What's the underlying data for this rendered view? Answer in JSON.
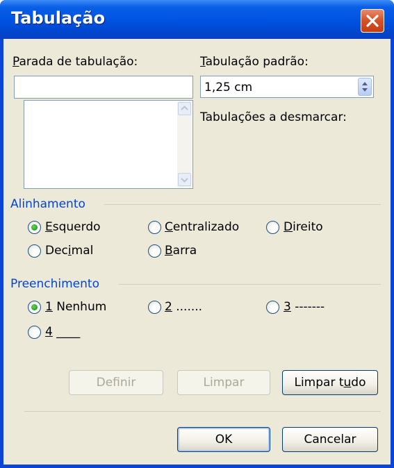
{
  "window": {
    "title": "Tabulação"
  },
  "tab_stop": {
    "label_prefix": "P",
    "label_rest": "arada de tabulação:",
    "value": ""
  },
  "default_tab": {
    "label_prefix": "T",
    "label_rest": "abulação padrão:",
    "value": "1,25 cm"
  },
  "clear_label": "Tabulações a desmarcar:",
  "alignment": {
    "title": "Alinhamento",
    "options": [
      {
        "u": "E",
        "rest": "squerdo",
        "pre": "",
        "selected": true
      },
      {
        "u": "C",
        "rest": "entralizado",
        "pre": "",
        "selected": false
      },
      {
        "u": "D",
        "rest": "ireito",
        "pre": "",
        "selected": false
      },
      {
        "pre": "Dec",
        "u": "i",
        "rest": "mal",
        "selected": false
      },
      {
        "u": "B",
        "rest": "arra",
        "pre": "",
        "selected": false
      }
    ]
  },
  "leader": {
    "title": "Preenchimento",
    "options": [
      {
        "u": "1",
        "rest": " Nenhum",
        "selected": true
      },
      {
        "u": "2",
        "rest": " .......",
        "selected": false
      },
      {
        "u": "3",
        "rest": " -------",
        "selected": false
      },
      {
        "u": "4",
        "rest": " ____",
        "selected": false
      }
    ]
  },
  "buttons": {
    "set": "Definir",
    "clear": "Limpar",
    "clear_all_pre": "Limpar t",
    "clear_all_u": "u",
    "clear_all_post": "do",
    "ok": "OK",
    "cancel": "Cancelar"
  }
}
